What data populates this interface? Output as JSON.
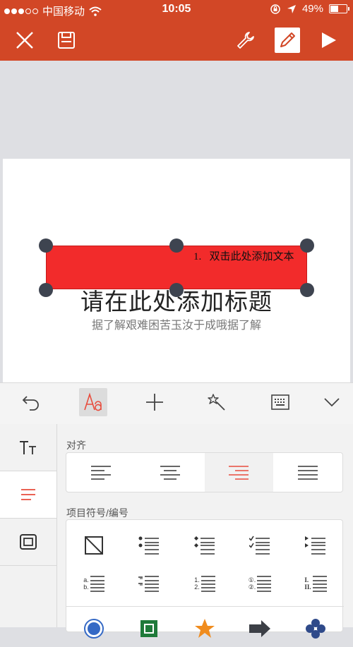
{
  "status_bar": {
    "carrier": "中国移动",
    "time": "10:05",
    "battery": "49%",
    "battery_level": 0.49,
    "signal_dots_filled": 3,
    "signal_dots_total": 5
  },
  "colors": {
    "accent": "#d24726",
    "shape_fill": "#f22b2b",
    "handle": "#3e4450",
    "selected_red": "#e84c3d"
  },
  "toolbar": {
    "icons": [
      "close-icon",
      "save-icon",
      "wrench-icon",
      "pen-icon",
      "play-icon"
    ]
  },
  "slide": {
    "title_placeholder": "请在此处添加标题",
    "subtitle": "据了解艰难困苦玉汝于成哦据了解",
    "shape_text_number": "1.",
    "shape_text": "双击此处添加文本"
  },
  "format_tabs": {
    "icons": [
      "undo-icon",
      "text-format-icon",
      "insert-icon",
      "magic-wand-icon",
      "keyboard-icon",
      "chevron-down-icon"
    ],
    "selected": "text-format-icon"
  },
  "side_nav": {
    "items": [
      "font-icon",
      "paragraph-icon",
      "textbox-icon"
    ],
    "selected": "paragraph-icon"
  },
  "alignment": {
    "label": "对齐",
    "options": [
      "align-left-icon",
      "align-center-icon",
      "align-right-icon",
      "justify-icon"
    ],
    "selected": "align-right-icon"
  },
  "list_section": {
    "label": "项目符号/编号",
    "row1": [
      "no-bullet-icon",
      "bullet-dots-icon",
      "bullet-diamonds-icon",
      "bullet-checks-icon",
      "bullet-arrows-icon"
    ],
    "row2": [
      "numbering-letters-icon",
      "numbering-dashes-icon",
      "numbering-digits-icon",
      "numbering-circled-icon",
      "numbering-roman-icon"
    ],
    "row3": [
      "bullet-circle-icon",
      "bullet-square-icon",
      "bullet-star-icon",
      "bullet-arrow-icon",
      "bullet-clover-icon"
    ],
    "row2_labels": {
      "letters": [
        "a.",
        "b."
      ],
      "digits": [
        "1.",
        "2."
      ],
      "circled": [
        "①.",
        "②."
      ],
      "roman": [
        "I.",
        "II."
      ]
    }
  }
}
